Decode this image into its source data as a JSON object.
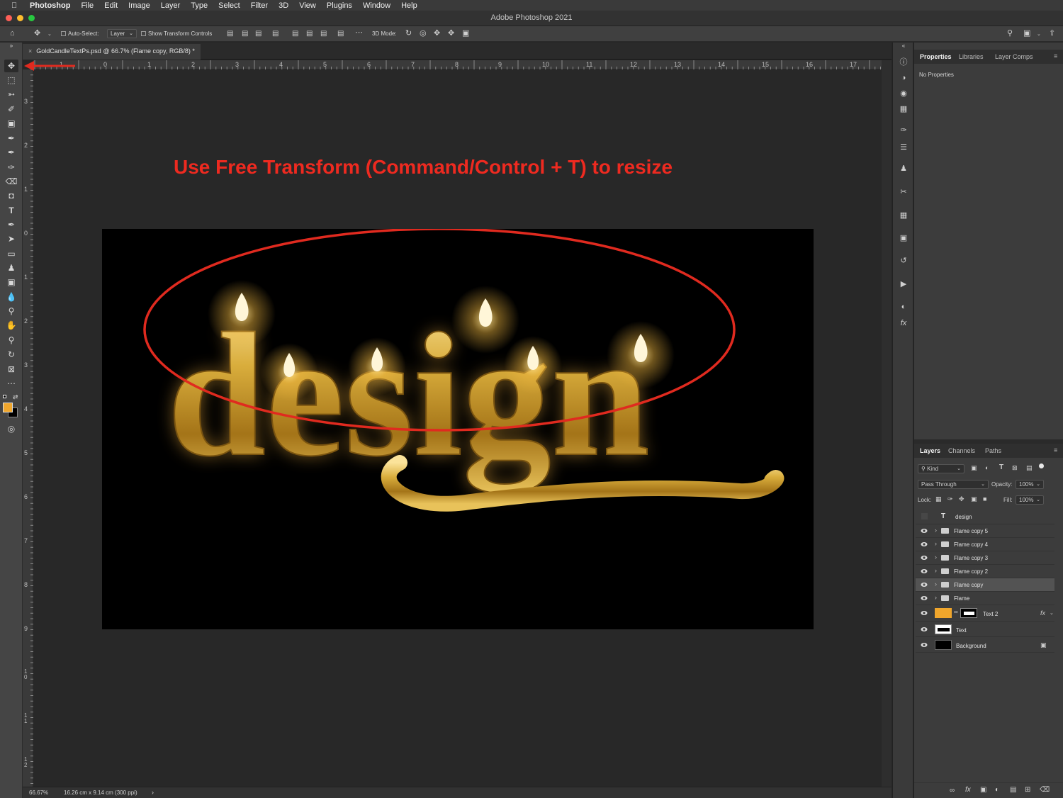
{
  "menubar": {
    "app_name": "Photoshop",
    "items": [
      "File",
      "Edit",
      "Image",
      "Layer",
      "Type",
      "Select",
      "Filter",
      "3D",
      "View",
      "Plugins",
      "Window",
      "Help"
    ]
  },
  "window": {
    "title": "Adobe Photoshop 2021"
  },
  "options_bar": {
    "auto_select_label": "Auto-Select:",
    "auto_select_value": "Layer",
    "show_transform_label": "Show Transform Controls",
    "mode_3d_label": "3D Mode:"
  },
  "document": {
    "tab_title": "GoldCandleTextPs.psd @ 66.7% (Flame copy, RGB/8) *",
    "annotation": "Use Free Transform (Command/Control + T) to resize",
    "artwork_word": "design"
  },
  "rulers": {
    "horizontal": [
      "1",
      "0",
      "1",
      "2",
      "3",
      "4",
      "5",
      "6",
      "7",
      "8",
      "9",
      "10",
      "11",
      "12",
      "13",
      "14",
      "15",
      "16",
      "17"
    ],
    "vertical": [
      "3",
      "2",
      "1",
      "0",
      "1",
      "2",
      "3",
      "4",
      "5",
      "6",
      "7",
      "8",
      "9",
      "10",
      "11",
      "12"
    ]
  },
  "status_bar": {
    "zoom": "66.67%",
    "doc_size": "16.26 cm x 9.14 cm (300 ppi)"
  },
  "properties_panel": {
    "tabs": [
      "Properties",
      "Libraries",
      "Layer Comps"
    ],
    "content": "No Properties"
  },
  "layers_panel": {
    "tabs": [
      "Layers",
      "Channels",
      "Paths"
    ],
    "filter_kind": "Kind",
    "blend_mode": "Pass Through",
    "opacity_label": "Opacity:",
    "opacity_value": "100%",
    "lock_label": "Lock:",
    "fill_label": "Fill:",
    "fill_value": "100%",
    "layers": [
      {
        "name": "design",
        "kind": "type",
        "visible": false
      },
      {
        "name": "Flame copy 5",
        "kind": "group",
        "visible": true
      },
      {
        "name": "Flame copy 4",
        "kind": "group",
        "visible": true
      },
      {
        "name": "Flame copy 3",
        "kind": "group",
        "visible": true
      },
      {
        "name": "Flame copy 2",
        "kind": "group",
        "visible": true
      },
      {
        "name": "Flame copy",
        "kind": "group",
        "visible": true,
        "selected": true
      },
      {
        "name": "Flame",
        "kind": "group",
        "visible": true
      },
      {
        "name": "Text 2",
        "kind": "fill",
        "visible": true,
        "fx": "fx"
      },
      {
        "name": "Text",
        "kind": "pixel",
        "visible": true
      },
      {
        "name": "Background",
        "kind": "background",
        "visible": true,
        "locked": true
      }
    ]
  },
  "colors": {
    "foreground": "#f0a62c",
    "background": "#000000",
    "annotation": "#ee2a20",
    "gold": "#d9ad3c"
  }
}
